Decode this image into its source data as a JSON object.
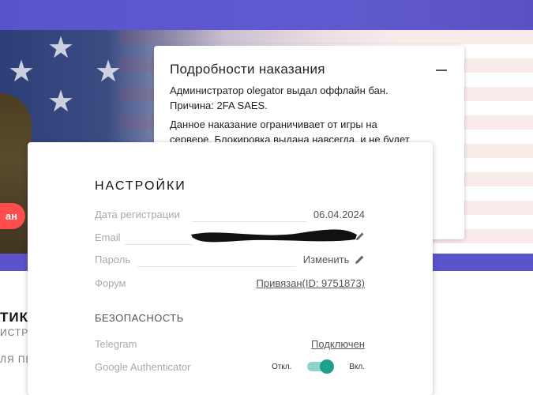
{
  "punishment": {
    "title": "Подробности наказания",
    "line1": "Администратор olegator выдал оффлайн бан.",
    "line2": "Причина: 2FA SAES.",
    "line3": "Данное наказание ограничивает от игры на",
    "line4": "сервере. Блокировка выдана навсегда, и не будет"
  },
  "hero": {
    "ban_button_label": "ан"
  },
  "background": {
    "left_title": "ТИК",
    "left_subtitle": "ИСТРА",
    "left_subtitle2": "ЛЯ ПЕ"
  },
  "settings": {
    "title": "НАСТРОЙКИ",
    "registration_label": "Дата регистрации",
    "registration_value": "06.04.2024",
    "email_label": "Email",
    "password_label": "Пароль",
    "password_action": "Изменить",
    "forum_label": "Форум",
    "forum_value": "Привязан(ID: 9751873)",
    "security_title": "БЕЗОПАСНОСТЬ",
    "telegram_label": "Telegram",
    "telegram_value": "Подключен",
    "ga_label": "Google Authenticator",
    "ga_off": "Откл.",
    "ga_on": "Вкл."
  },
  "colors": {
    "accent": "#5b53c9",
    "ban_red": "#ff4d4d",
    "toggle_teal": "#1fa08f"
  }
}
